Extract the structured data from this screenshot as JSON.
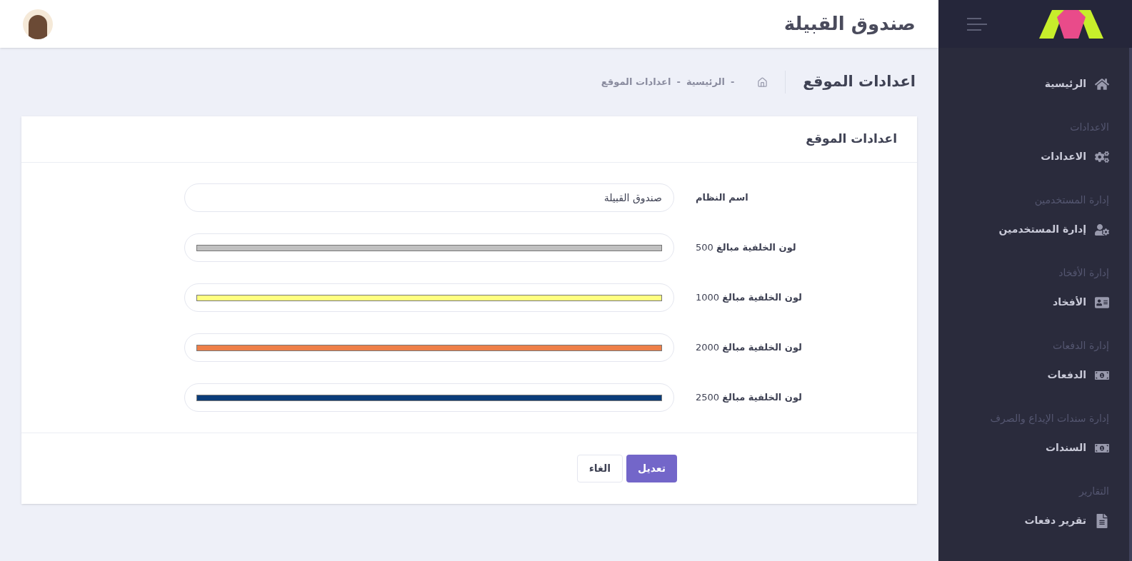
{
  "header": {
    "title": "صندوق القبيلة"
  },
  "page": {
    "title": "اعدادات الموقع",
    "breadcrumb": [
      "-",
      "الرئيسية",
      "-",
      "اعدادات الموقع"
    ]
  },
  "card": {
    "title": "اعدادات الموقع",
    "fields": [
      {
        "kind": "text",
        "label": "اسم النظام",
        "value": "صندوق القبيلة"
      },
      {
        "kind": "color",
        "label": "لون الخلفية مبالغ",
        "amount": "500",
        "color": "#c0c0c0"
      },
      {
        "kind": "color",
        "label": "لون الخلفية مبالغ",
        "amount": "1000",
        "color": "#ffff80"
      },
      {
        "kind": "color",
        "label": "لون الخلفية مبالغ",
        "amount": "2000",
        "color": "#ee7f48"
      },
      {
        "kind": "color",
        "label": "لون الخلفية مبالغ",
        "amount": "2500",
        "color": "#0b3d7a"
      }
    ],
    "buttons": [
      {
        "label": "تعديل",
        "kind": "primary"
      },
      {
        "label": "الغاء",
        "kind": "secondary"
      }
    ]
  },
  "sidebar": {
    "items": [
      {
        "kind": "link",
        "label": "الرئيسية"
      },
      {
        "kind": "section",
        "label": "الاعدادات"
      },
      {
        "kind": "link",
        "label": "الاعدادات"
      },
      {
        "kind": "section",
        "label": "إدارة المستخدمين"
      },
      {
        "kind": "link",
        "label": "إدارة المستخدمين"
      },
      {
        "kind": "section",
        "label": "إدارة الأفخاد"
      },
      {
        "kind": "link",
        "label": "الأفخاد"
      },
      {
        "kind": "section",
        "label": "إدارة الدفعات"
      },
      {
        "kind": "link",
        "label": "الدفعات"
      },
      {
        "kind": "section",
        "label": "إدارة سندات الإيداع والصرف"
      },
      {
        "kind": "link",
        "label": "السندات"
      },
      {
        "kind": "section",
        "label": "التقارير"
      },
      {
        "kind": "link",
        "label": "تقرير دفعات"
      }
    ]
  }
}
